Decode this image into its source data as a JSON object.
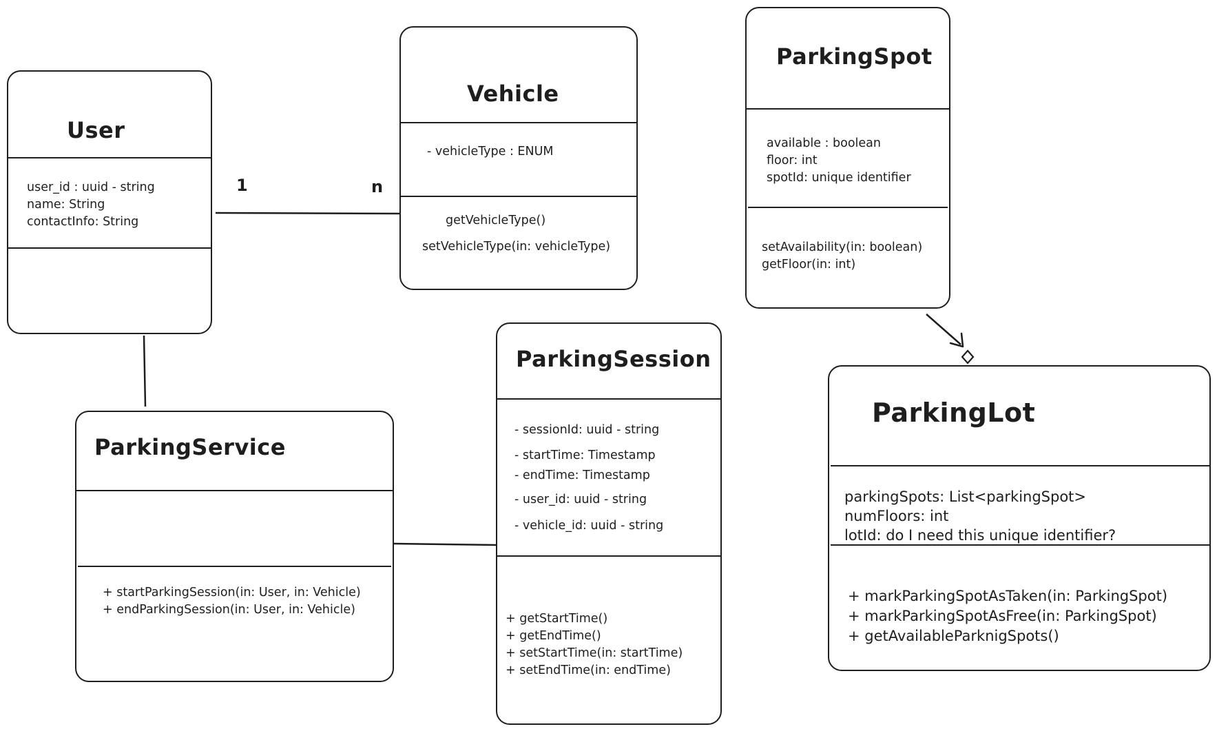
{
  "classes": {
    "user": {
      "name": "User",
      "attributes": [
        "user_id : uuid - string",
        "name: String",
        "contactInfo: String"
      ],
      "methods": []
    },
    "vehicle": {
      "name": "Vehicle",
      "attributes": [
        "- vehicleType : ENUM"
      ],
      "methods": [
        "getVehicleType()",
        "setVehicleType(in: vehicleType)"
      ]
    },
    "parking_spot": {
      "name": "ParkingSpot",
      "attributes": [
        "available : boolean",
        "floor: int",
        "spotId: unique identifier"
      ],
      "methods": [
        "setAvailability(in: boolean)",
        "getFloor(in: int)"
      ]
    },
    "parking_service": {
      "name": "ParkingService",
      "attributes": [],
      "methods": [
        "+ startParkingSession(in: User, in: Vehicle)",
        "+ endParkingSession(in: User, in: Vehicle)"
      ]
    },
    "parking_session": {
      "name": "ParkingSession",
      "attributes": [
        "- sessionId: uuid - string",
        "- startTime: Timestamp",
        "- endTime: Timestamp",
        "- user_id: uuid - string",
        "- vehicle_id: uuid - string"
      ],
      "methods": [
        "+ getStartTime()",
        "+ getEndTime()",
        "+ setStartTime(in: startTime)",
        "+ setEndTime(in: endTime)"
      ]
    },
    "parking_lot": {
      "name": "ParkingLot",
      "attributes": [
        "parkingSpots: List<parkingSpot>",
        "numFloors: int",
        "lotId: do I need this unique identifier?"
      ],
      "methods": [
        "+ markParkingSpotAsTaken(in: ParkingSpot)",
        "+ markParkingSpotAsFree(in: ParkingSpot)",
        "+ getAvailableParknigSpots()"
      ]
    }
  },
  "relations": {
    "user_vehicle": {
      "from_multiplicity": "1",
      "to_multiplicity": "n"
    }
  },
  "colors": {
    "stroke": "#1e1e1e",
    "background": "#ffffff"
  }
}
